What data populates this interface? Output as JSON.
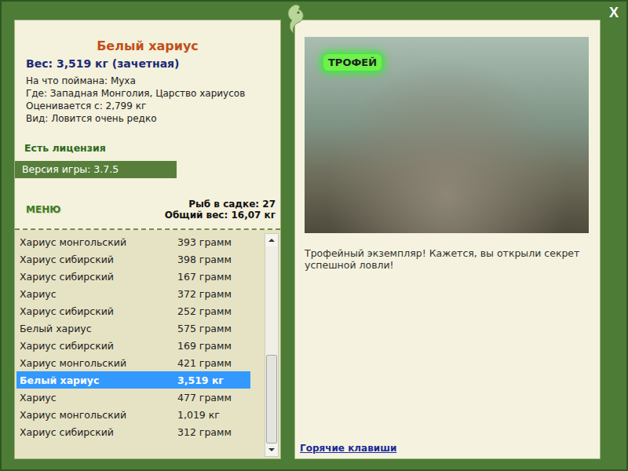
{
  "window": {
    "close": "X"
  },
  "fish": {
    "title": "Белый хариус",
    "weight": "Вес: 3,519 кг (зачетная)",
    "details": [
      "На что поймана: Муха",
      "Где: Западная Монголия, Царство хариусов",
      "Оценивается с: 2,799 кг",
      "Вид: Ловится очень редко"
    ]
  },
  "license": "Есть лицензия",
  "version": "Версия игры: 3.7.5",
  "menu": "МЕНЮ",
  "cage": {
    "count": "Рыб в садке: 27",
    "total": "Общий вес: 16,07 кг"
  },
  "catch_list": [
    {
      "name": "Хариус монгольский",
      "weight": "393 грамм",
      "selected": false
    },
    {
      "name": "Хариус сибирский",
      "weight": "398 грамм",
      "selected": false
    },
    {
      "name": "Хариус сибирский",
      "weight": "167 грамм",
      "selected": false
    },
    {
      "name": "Хариус",
      "weight": "372 грамм",
      "selected": false
    },
    {
      "name": "Хариус сибирский",
      "weight": "252 грамм",
      "selected": false
    },
    {
      "name": "Белый хариус",
      "weight": "575 грамм",
      "selected": false
    },
    {
      "name": "Хариус сибирский",
      "weight": "169 грамм",
      "selected": false
    },
    {
      "name": "Хариус монгольский",
      "weight": "421 грамм",
      "selected": false
    },
    {
      "name": "Белый хариус",
      "weight": "3,519 кг",
      "selected": true
    },
    {
      "name": "Хариус",
      "weight": "477 грамм",
      "selected": false
    },
    {
      "name": "Хариус монгольский",
      "weight": "1,019 кг",
      "selected": false
    },
    {
      "name": "Хариус сибирский",
      "weight": "312 грамм",
      "selected": false
    }
  ],
  "scrollbar": {
    "thumb_start": 0.55,
    "thumb_size": 0.45
  },
  "photo": {
    "badge": "ТРОФЕЙ"
  },
  "message": "Трофейный экземпляр! Кажется, вы открыли секрет успешной ловли!",
  "hotkeys_link": "Горячие клавиши"
}
